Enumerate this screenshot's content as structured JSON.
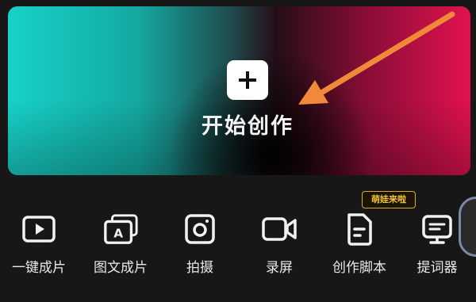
{
  "hero": {
    "label": "开始创作",
    "plus_icon": "plus-icon"
  },
  "tools": [
    {
      "label": "一键成片",
      "icon": "play-window-icon"
    },
    {
      "label": "图文成片",
      "icon": "text-to-video-icon"
    },
    {
      "label": "拍摄",
      "icon": "camera-icon"
    },
    {
      "label": "录屏",
      "icon": "video-camera-icon"
    },
    {
      "label": "创作脚本",
      "icon": "document-icon"
    },
    {
      "label": "提词器",
      "icon": "teleprompter-icon"
    }
  ],
  "watermark_badge": "萌娃来啦",
  "colors": {
    "background": "#171717",
    "hero_left": "#17d2c8",
    "hero_right": "#e2124f",
    "arrow": "#f08a3a",
    "badge": "#f0c23a"
  }
}
